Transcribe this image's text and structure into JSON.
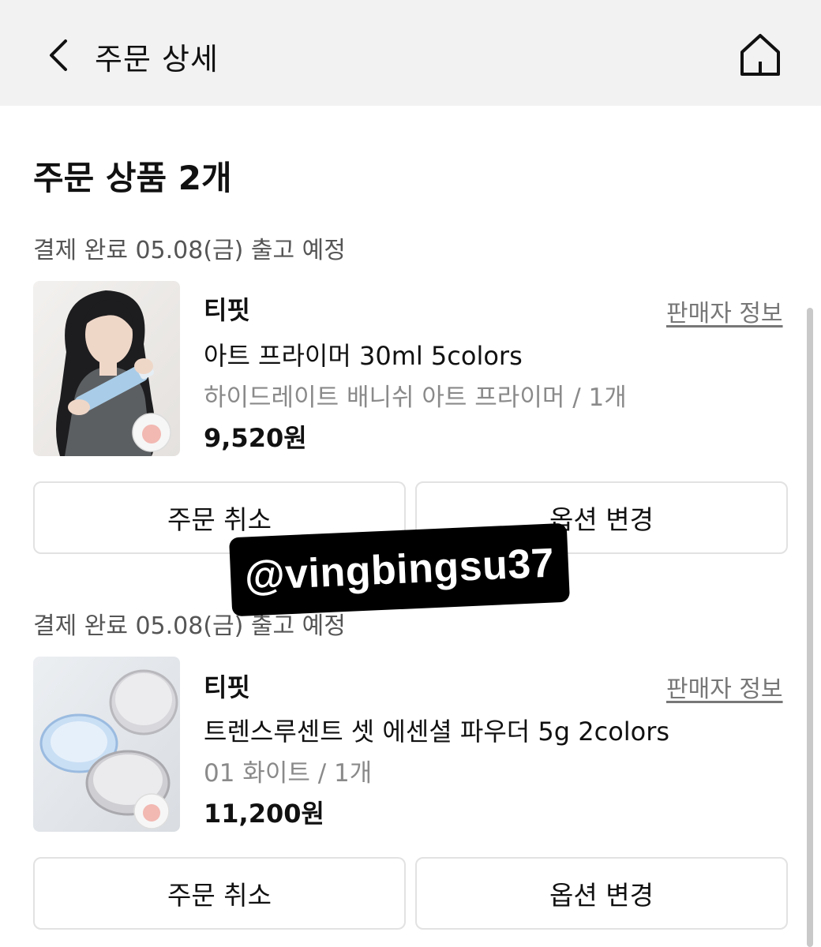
{
  "header": {
    "title": "주문 상세",
    "back_icon": "chevron-left-icon",
    "home_icon": "home-icon",
    "background": "#f2f2f2"
  },
  "section": {
    "title": "주문 상품 2개"
  },
  "orders": [
    {
      "status": "결제 완료 05.08(금) 출고 예정",
      "seller": "티핏",
      "seller_info_label": "판매자 정보",
      "product_name": "아트 프라이머 30ml 5colors",
      "option": "하이드레이트 배니쉬 아트 프라이머 / 1개",
      "price": "9,520원",
      "cancel_label": "주문 취소",
      "change_option_label": "옵션 변경"
    },
    {
      "status": "결제 완료 05.08(금) 출고 예정",
      "seller": "티핏",
      "seller_info_label": "판매자 정보",
      "product_name": "트렌스루센트 셋 에센셜 파우더 5g 2colors",
      "option": "01 화이트 / 1개",
      "price": "11,200원",
      "cancel_label": "주문 취소",
      "change_option_label": "옵션 변경"
    }
  ],
  "watermark": {
    "text": "@vingbingsu37"
  },
  "colors": {
    "muted_text": "#8a8a8a",
    "status_text": "#555555",
    "button_border": "#e2e2e2"
  }
}
